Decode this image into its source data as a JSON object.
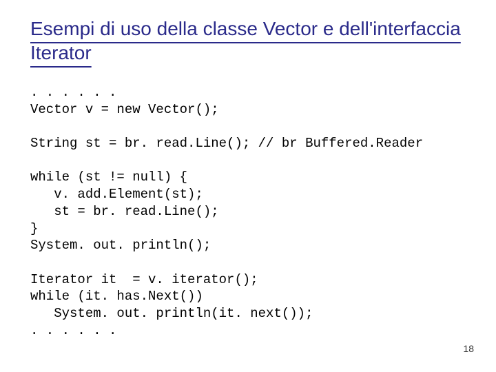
{
  "title": "Esempi di uso della classe Vector e dell'interfaccia Iterator",
  "code": {
    "l01": ". . . . . .",
    "l02": "Vector v = new Vector();",
    "l03": "",
    "l04": "String st = br. read.Line(); // br Buffered.Reader",
    "l05": "",
    "l06": "while (st != null) {",
    "l07": "   v. add.Element(st);",
    "l08": "   st = br. read.Line();",
    "l09": "}",
    "l10": "System. out. println();",
    "l11": "",
    "l12": "Iterator it  = v. iterator();",
    "l13": "while (it. has.Next())",
    "l14": "   System. out. println(it. next());",
    "l15": ". . . . . ."
  },
  "page_number": "18"
}
